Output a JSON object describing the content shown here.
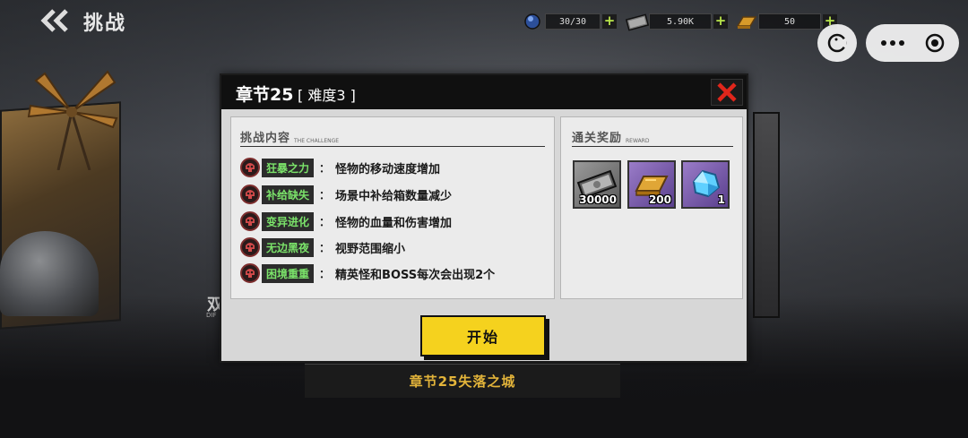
{
  "topbar": {
    "title": "挑战",
    "resources": [
      {
        "icon": "energy-orb-icon",
        "value": "30/30"
      },
      {
        "icon": "cash-stack-icon",
        "value": "5.90K"
      },
      {
        "icon": "gold-bar-icon",
        "value": "50"
      }
    ]
  },
  "dialog": {
    "title": "章节25",
    "difficulty": "[ 难度3 ]",
    "challenge_head": "挑战内容",
    "challenge_head_en": "THE CHALLENGE",
    "reward_head": "通关奖励",
    "reward_head_en": "REWARD",
    "rules": [
      {
        "tag": "狂暴之力",
        "desc": "怪物的移动速度增加"
      },
      {
        "tag": "补给缺失",
        "desc": "场景中补给箱数量减少"
      },
      {
        "tag": "变异进化",
        "desc": "怪物的血量和伤害增加"
      },
      {
        "tag": "无边黑夜",
        "desc": "视野范围缩小"
      },
      {
        "tag": "困境重重",
        "desc": "精英怪和BOSS每次会出现2个"
      }
    ],
    "rewards": [
      {
        "icon": "cash-stack-icon",
        "count": "30000"
      },
      {
        "icon": "gold-bar-icon",
        "count": "200"
      },
      {
        "icon": "blue-crystal-icon",
        "count": "1"
      }
    ],
    "colon": "：",
    "start_label": "开始"
  },
  "chapter_name": "章节25失落之城",
  "colors": {
    "accent_yellow": "#f5d21e",
    "tag_green": "#7be36a",
    "close_red": "#e0261b",
    "chapter_gold": "#e3b43a"
  }
}
